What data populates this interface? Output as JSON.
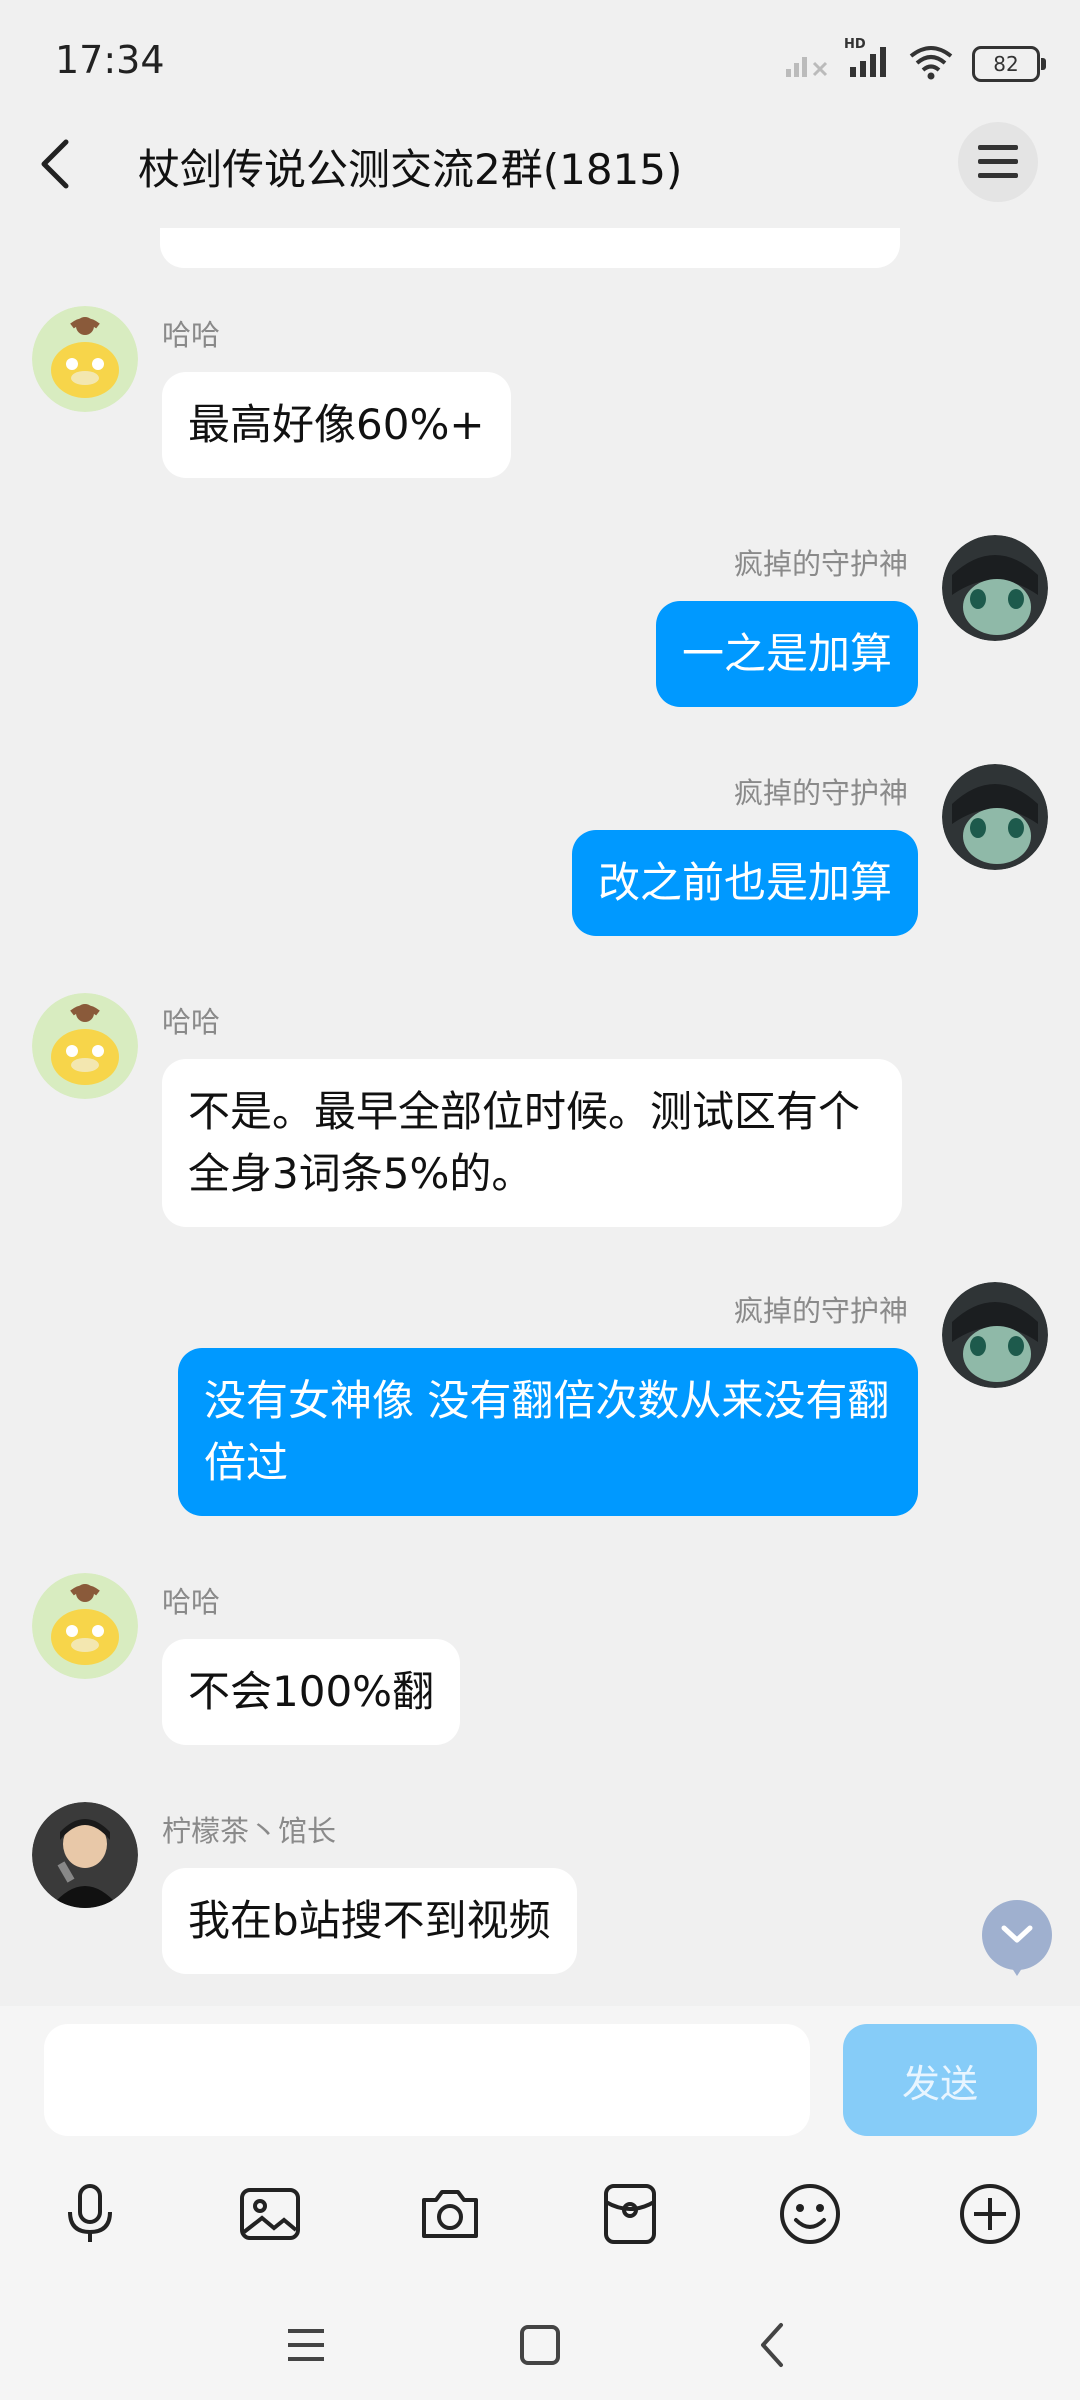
{
  "status_bar": {
    "time": "17:34",
    "battery": "82",
    "hd_label": "HD",
    "icons": [
      "signal-off-icon",
      "signal-icon",
      "wifi-icon",
      "battery-icon"
    ]
  },
  "header": {
    "title": "杖剑传说公测交流2群(1815)",
    "icons": [
      "back-icon",
      "menu-icon"
    ]
  },
  "messages": [
    {
      "side": "left",
      "sender": "哈哈",
      "avatar": "duck-avatar",
      "text": "最高好像60%+"
    },
    {
      "side": "right",
      "sender": "疯掉的守护神",
      "avatar": "anime-avatar",
      "text": "一之是加算"
    },
    {
      "side": "right",
      "sender": "疯掉的守护神",
      "avatar": "anime-avatar",
      "text": "改之前也是加算"
    },
    {
      "side": "left",
      "sender": "哈哈",
      "avatar": "duck-avatar",
      "text": "不是。最早全部位时候。测试区有个全身3词条5%的。"
    },
    {
      "side": "right",
      "sender": "疯掉的守护神",
      "avatar": "anime-avatar",
      "text": "没有女神像 没有翻倍次数从来没有翻倍过"
    },
    {
      "side": "left",
      "sender": "哈哈",
      "avatar": "duck-avatar",
      "text": "不会100%翻"
    },
    {
      "side": "left",
      "sender": "柠檬茶丶馆长",
      "avatar": "singer-avatar",
      "text": "我在b站搜不到视频"
    }
  ],
  "input": {
    "value": "",
    "placeholder": "",
    "send_label": "发送"
  },
  "toolbar": [
    "microphone-icon",
    "image-icon",
    "camera-icon",
    "red-packet-icon",
    "emoji-icon",
    "plus-icon"
  ],
  "nav": [
    "menu-lines-icon",
    "home-square-icon",
    "back-arrow-icon"
  ],
  "colors": {
    "background": "#f0f0f0",
    "own_bubble": "#0099ff",
    "other_bubble": "#ffffff",
    "send_button": "#86ccf8",
    "sender_name": "#8a8a8a"
  }
}
